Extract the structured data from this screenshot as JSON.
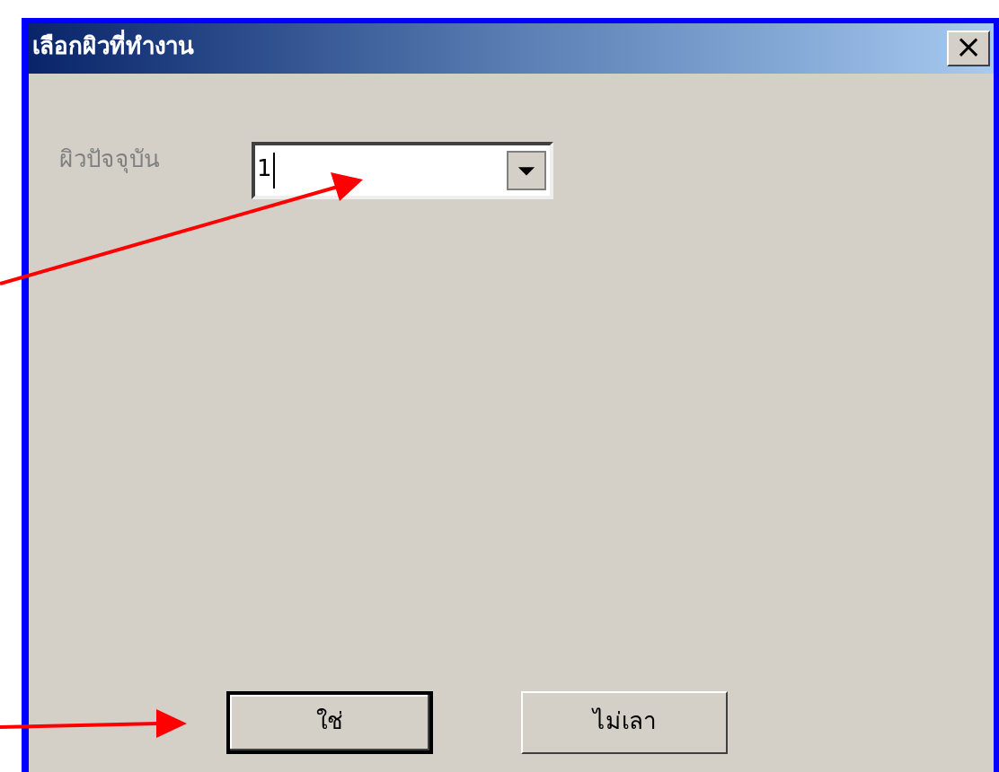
{
  "window": {
    "title": "เลือกผิวที่ทำงาน",
    "close": "×"
  },
  "field": {
    "label": "ผิวปัจจุบัน",
    "disabled": true,
    "value": "1"
  },
  "buttons": [
    {
      "label": "ใช่",
      "default": true
    },
    {
      "label": "ไม่เลา",
      "default": false
    }
  ]
}
